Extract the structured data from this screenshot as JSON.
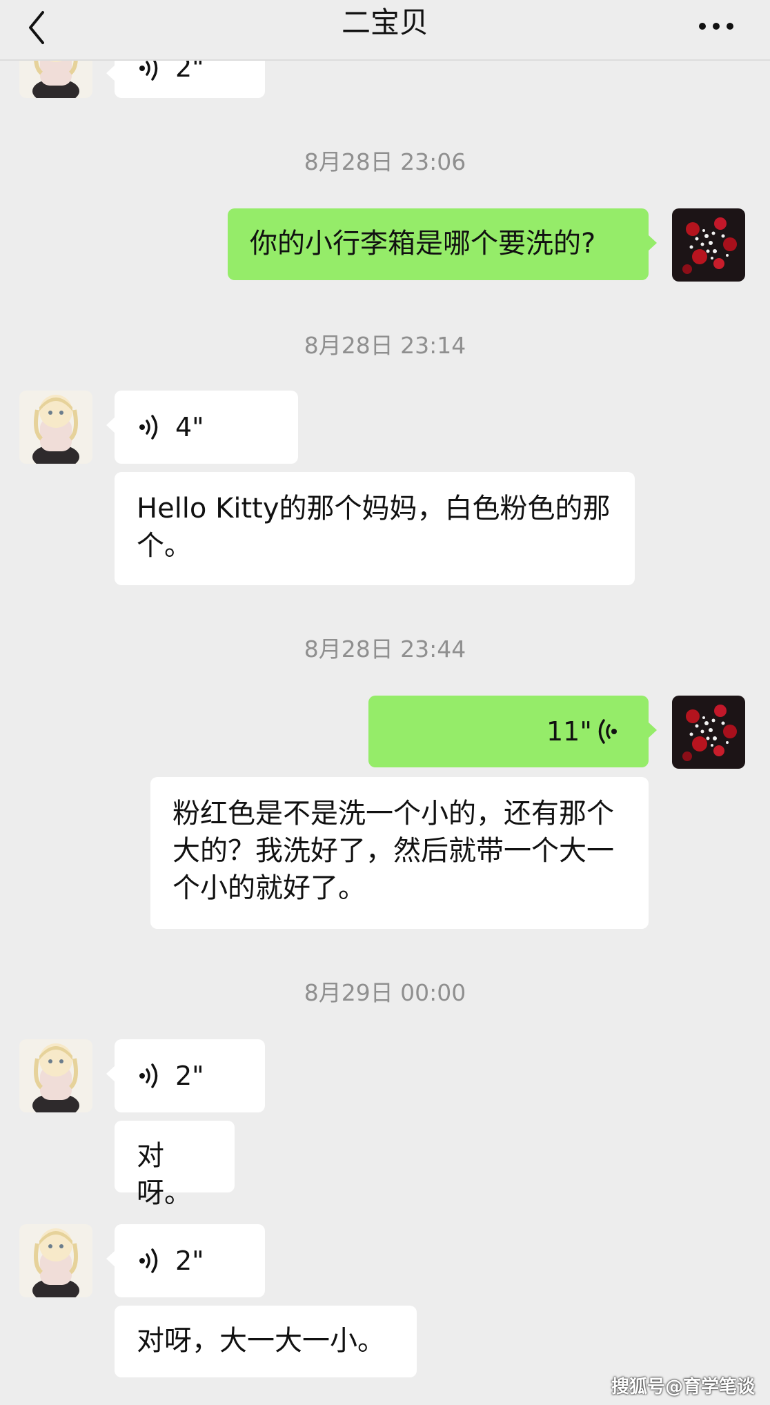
{
  "header": {
    "title": "二宝贝",
    "back_icon": "chevron-left-icon",
    "more_icon": "more-dots-icon"
  },
  "colors": {
    "background": "#ededed",
    "incoming_bubble": "#ffffff",
    "outgoing_bubble": "#95ec69",
    "timestamp": "#8f8f8f"
  },
  "messages": {
    "m0_voice": "2\"",
    "ts1": "8月28日 23:06",
    "m1_text": "你的小行李箱是哪个要洗的?",
    "ts2": "8月28日 23:14",
    "m2_voice": "4\"",
    "m3_text": "Hello Kitty的那个妈妈，白色粉色的那个。",
    "ts3": "8月28日 23:44",
    "m4_voice": "11\"",
    "m5_text": "粉红色是不是洗一个小的，还有那个大的？我洗好了，然后就带一个大一个小的就好了。",
    "ts4": "8月29日 00:00",
    "m6_voice": "2\"",
    "m7_text": "对呀。",
    "m8_voice": "2\"",
    "m9_text": "对呀，大一大一小。"
  },
  "watermark": "搜狐号@育学笔谈"
}
